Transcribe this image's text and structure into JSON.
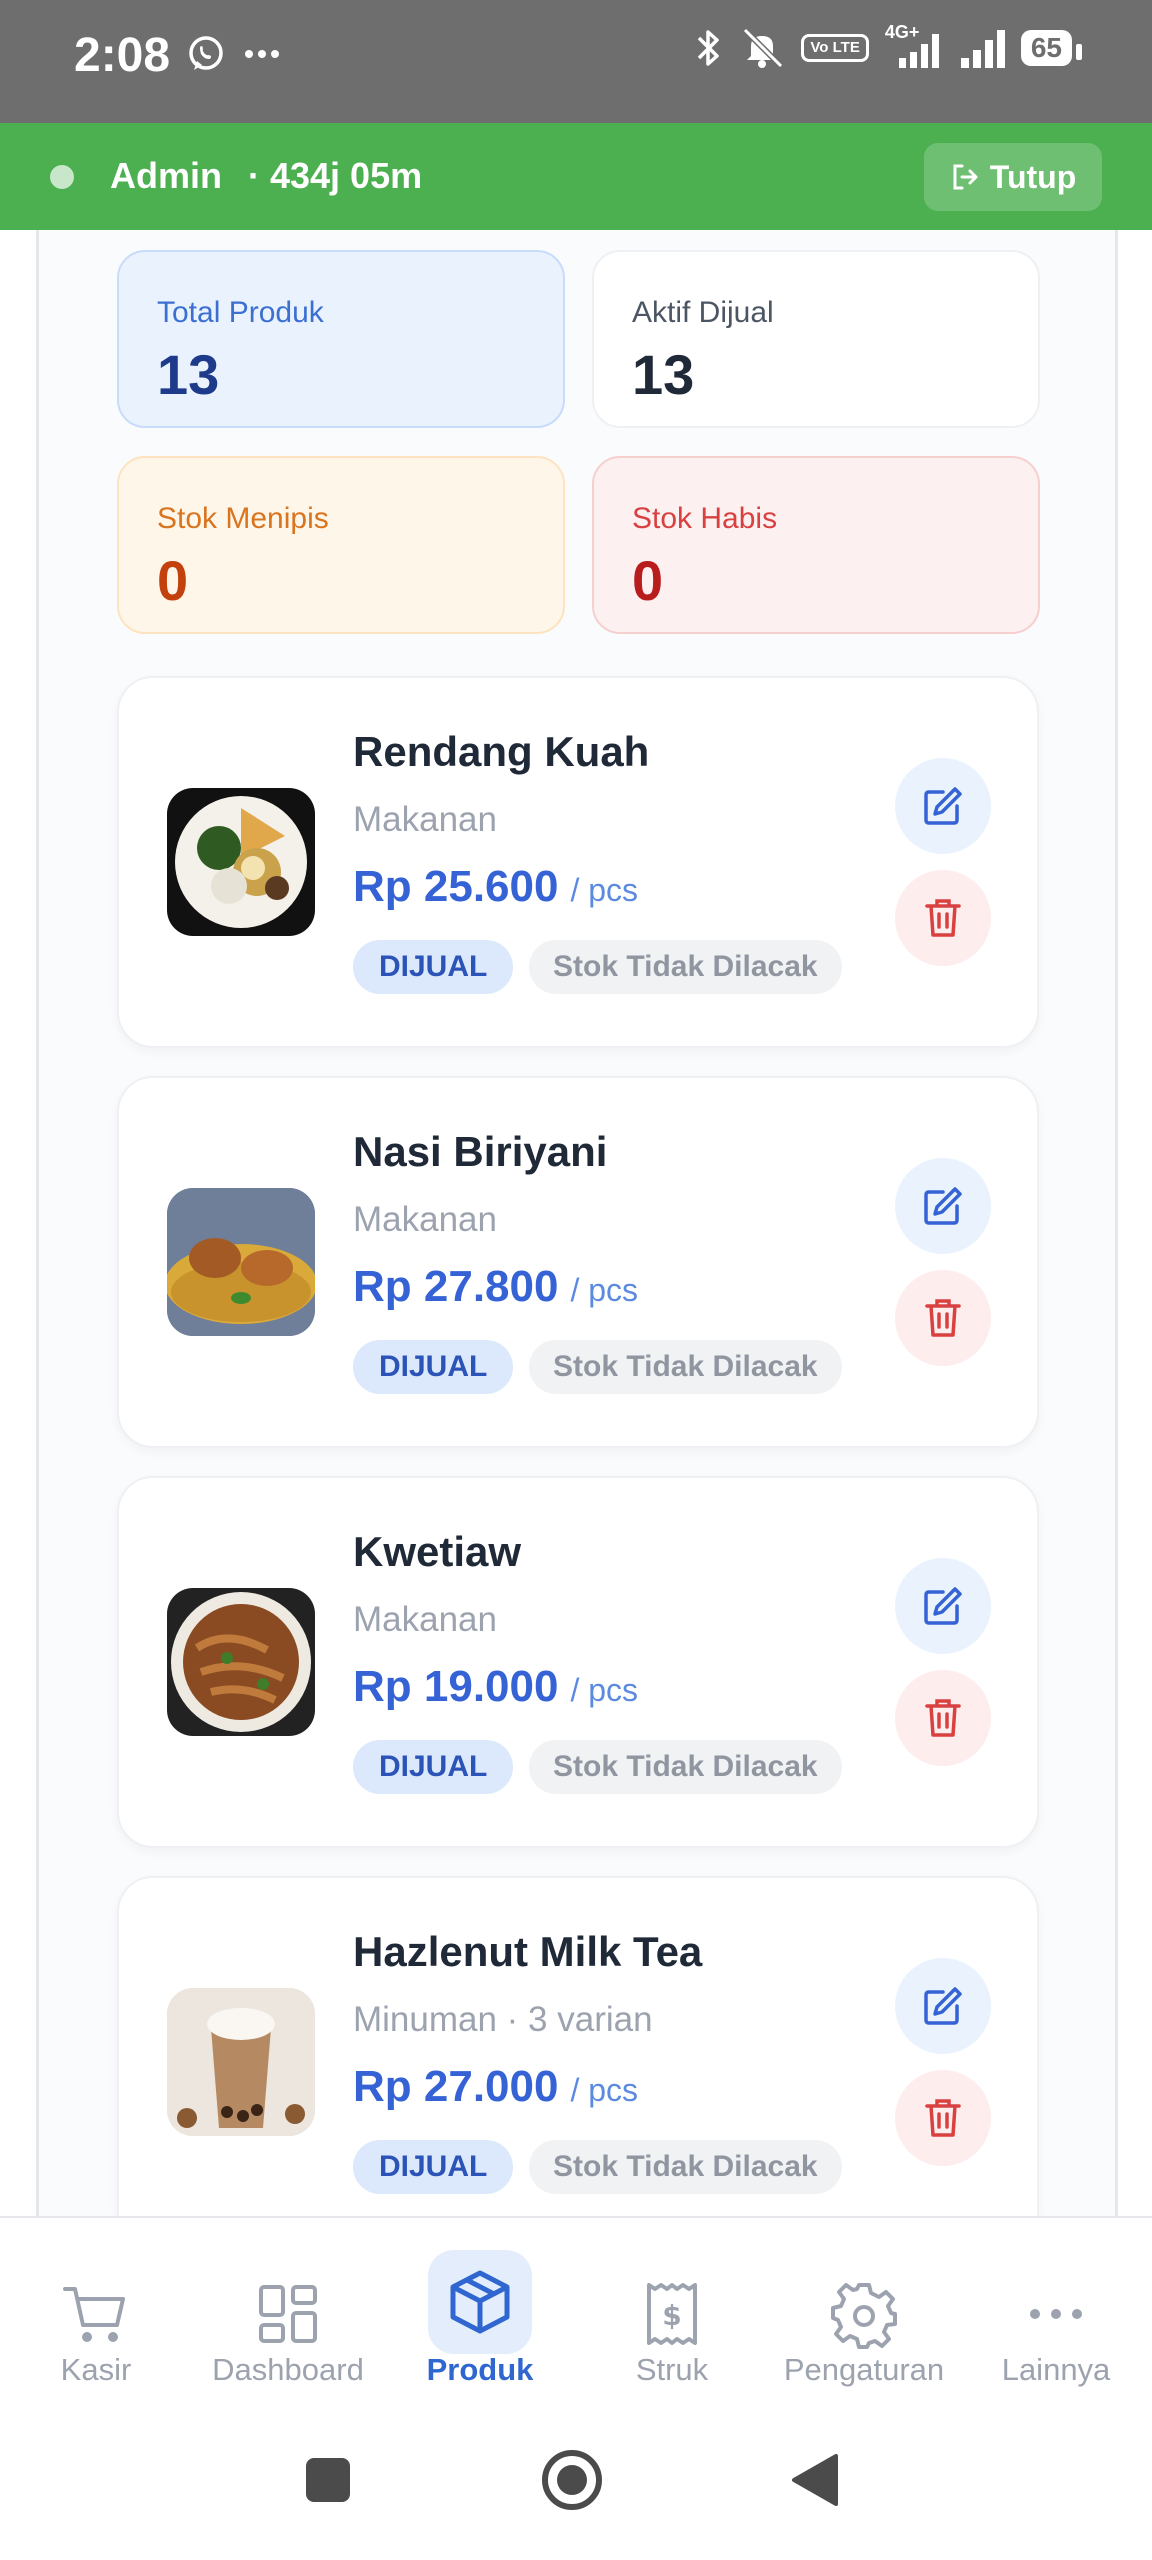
{
  "status_bar": {
    "time": "2:08",
    "volte": "Vo LTE",
    "network": "4G+",
    "battery": "65"
  },
  "admin_bar": {
    "name": "Admin",
    "session": "· 434j 05m",
    "logout_label": "Tutup"
  },
  "stats": {
    "total": {
      "label": "Total Produk",
      "value": "13"
    },
    "aktif": {
      "label": "Aktif Dijual",
      "value": "13"
    },
    "menipis": {
      "label": "Stok Menipis",
      "value": "0"
    },
    "habis": {
      "label": "Stok Habis",
      "value": "0"
    }
  },
  "products": [
    {
      "name": "Rendang Kuah",
      "category": "Makanan",
      "price": "Rp 25.600",
      "unit": "/ pcs",
      "status": "DIJUAL",
      "stock": "Stok Tidak Dilacak"
    },
    {
      "name": "Nasi Biriyani",
      "category": "Makanan",
      "price": "Rp 27.800",
      "unit": "/ pcs",
      "status": "DIJUAL",
      "stock": "Stok Tidak Dilacak"
    },
    {
      "name": "Kwetiaw",
      "category": "Makanan",
      "price": "Rp 19.000",
      "unit": "/ pcs",
      "status": "DIJUAL",
      "stock": "Stok Tidak Dilacak"
    },
    {
      "name": "Hazlenut Milk Tea",
      "category": "Minuman · 3 varian",
      "price": "Rp 27.000",
      "unit": "/ pcs",
      "status": "DIJUAL",
      "stock": "Stok Tidak Dilacak"
    }
  ],
  "nav": [
    {
      "label": "Kasir",
      "icon": "cart-icon"
    },
    {
      "label": "Dashboard",
      "icon": "dashboard-icon"
    },
    {
      "label": "Produk",
      "icon": "box-icon",
      "active": true
    },
    {
      "label": "Struk",
      "icon": "receipt-icon"
    },
    {
      "label": "Pengaturan",
      "icon": "gear-icon"
    },
    {
      "label": "Lainnya",
      "icon": "more-icon"
    }
  ],
  "colors": {
    "header_green": "#4caf50",
    "accent_blue": "#3563d6",
    "delete_red": "#d94141",
    "status_gray": "#6e6e6e"
  }
}
